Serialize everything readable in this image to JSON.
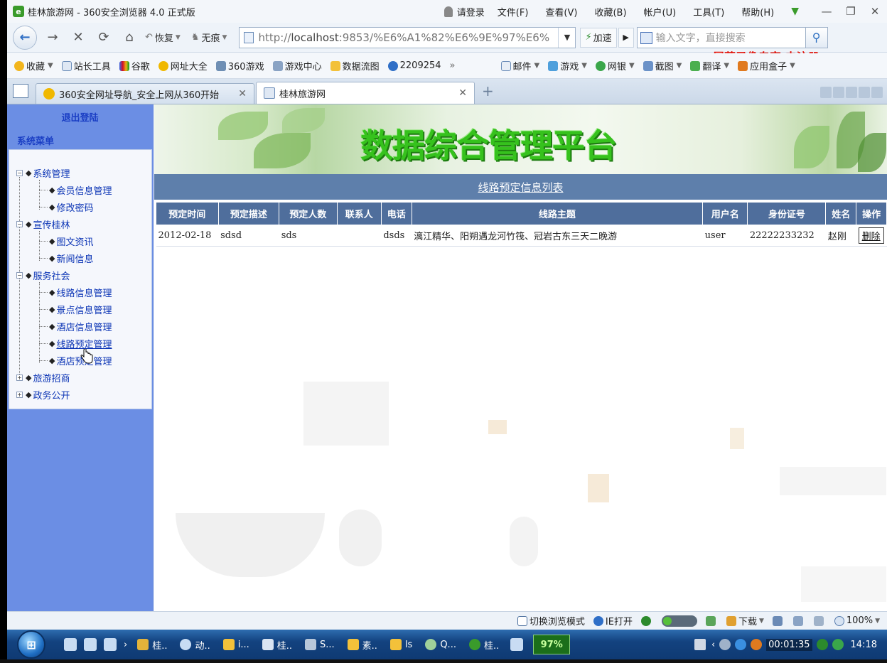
{
  "browser": {
    "window_title": "桂林旅游网 - 360安全浏览器 4.0 正式版",
    "login": "请登录",
    "menus": [
      "文件(F)",
      "查看(V)",
      "收藏(B)",
      "帐户(U)",
      "工具(T)",
      "帮助(H)"
    ],
    "restore_label": "恢复",
    "incognito_label": "无痕",
    "url_prefix": "http://",
    "url_host": "localhost",
    "url_rest": ":9853/%E6%A1%82%E6%9E%97%E6%",
    "accelerate_label": "加速",
    "search_placeholder": "输入文字，直接搜索",
    "watermark": "屏幕录像专家 未注册"
  },
  "favorites": {
    "items": [
      "收藏",
      "站长工具",
      "谷歌",
      "网址大全",
      "360游戏",
      "游戏中心",
      "数据流图",
      "2209254"
    ],
    "overflow": "»",
    "right_items": [
      "邮件",
      "游戏",
      "网银",
      "截图",
      "翻译",
      "应用盒子"
    ]
  },
  "tabs": [
    {
      "label": "360安全网址导航_安全上网从360开始",
      "active": false
    },
    {
      "label": "桂林旅游网",
      "active": true
    }
  ],
  "sidebar": {
    "logout": "退出登陆",
    "menu_title": "系统菜单",
    "groups": [
      {
        "label": "系统管理",
        "expanded": true,
        "children": [
          "会员信息管理",
          "修改密码"
        ]
      },
      {
        "label": "宣传桂林",
        "expanded": true,
        "children": [
          "图文资讯",
          "新闻信息"
        ]
      },
      {
        "label": "服务社会",
        "expanded": true,
        "children": [
          "线路信息管理",
          "景点信息管理",
          "酒店信息管理",
          "线路预定管理",
          "酒店预定管理"
        ]
      },
      {
        "label": "旅游招商",
        "expanded": false,
        "children": []
      },
      {
        "label": "政务公开",
        "expanded": false,
        "children": []
      }
    ]
  },
  "page": {
    "banner_title": "数据综合管理平台",
    "list_title": "线路预定信息列表",
    "table": {
      "headers": [
        "预定时间",
        "预定描述",
        "预定人数",
        "联系人",
        "电话",
        "线路主题",
        "用户名",
        "身份证号",
        "姓名",
        "操作"
      ],
      "rows": [
        {
          "time": "2012-02-18",
          "desc": "sdsd",
          "count": "sds",
          "contact": "",
          "phone": "dsds",
          "topic": "漓江精华、阳朔遇龙河竹筏、冠岩古东三天二晚游",
          "username": "user",
          "id_number": "22222233232",
          "name": "赵刚",
          "action": "删除"
        }
      ]
    }
  },
  "statusbar": {
    "switch_mode": "切换浏览模式",
    "ie_open": "IE打开",
    "download": "下载",
    "zoom": "100%"
  },
  "taskbar": {
    "tasks": [
      "桂..",
      "动..",
      "i...",
      "桂..",
      "S...",
      "素..",
      "ls",
      "Q...",
      "桂.."
    ],
    "cpu": "97%",
    "rec_time": "00:01:35",
    "clock": "14:18"
  },
  "colors": {
    "sidebar_bg": "#6b8ee4",
    "table_header_bg": "#4f6e9c",
    "list_header_bg": "#5e7fab",
    "banner_title": "#36c21d",
    "link_blue": "#0b34b5"
  }
}
